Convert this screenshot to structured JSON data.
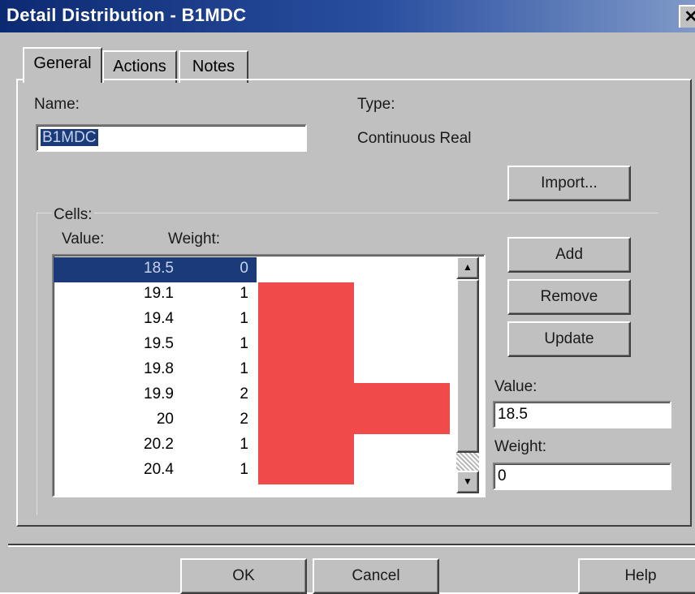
{
  "window": {
    "title": "Detail Distribution - B1MDC",
    "close_glyph": "✕"
  },
  "tabs": [
    {
      "label": "General",
      "active": true
    },
    {
      "label": "Actions",
      "active": false
    },
    {
      "label": "Notes",
      "active": false
    }
  ],
  "general": {
    "name_label": "Name:",
    "name_value": "B1MDC",
    "type_label": "Type:",
    "type_value": "Continuous Real",
    "import_label": "Import...",
    "cells_label": "Cells:",
    "value_header": "Value:",
    "weight_header": "Weight:",
    "rows": [
      {
        "value": "18.5",
        "weight": "0",
        "selected": true
      },
      {
        "value": "19.1",
        "weight": "1"
      },
      {
        "value": "19.4",
        "weight": "1"
      },
      {
        "value": "19.5",
        "weight": "1"
      },
      {
        "value": "19.8",
        "weight": "1"
      },
      {
        "value": "19.9",
        "weight": "2"
      },
      {
        "value": "20",
        "weight": "2"
      },
      {
        "value": "20.2",
        "weight": "1"
      },
      {
        "value": "20.4",
        "weight": "1"
      }
    ],
    "add_label": "Add",
    "remove_label": "Remove",
    "update_label": "Update",
    "value_field_label": "Value:",
    "value_field_value": "18.5",
    "weight_field_label": "Weight:",
    "weight_field_value": "0",
    "bar_color": "#f04a4a",
    "selection_color": "#1a3a7a"
  },
  "footer": {
    "ok_label": "OK",
    "cancel_label": "Cancel",
    "help_label": "Help"
  },
  "icons": {
    "scroll_up": "scroll-up-arrow-icon",
    "scroll_down": "scroll-down-arrow-icon",
    "close": "close-icon"
  }
}
